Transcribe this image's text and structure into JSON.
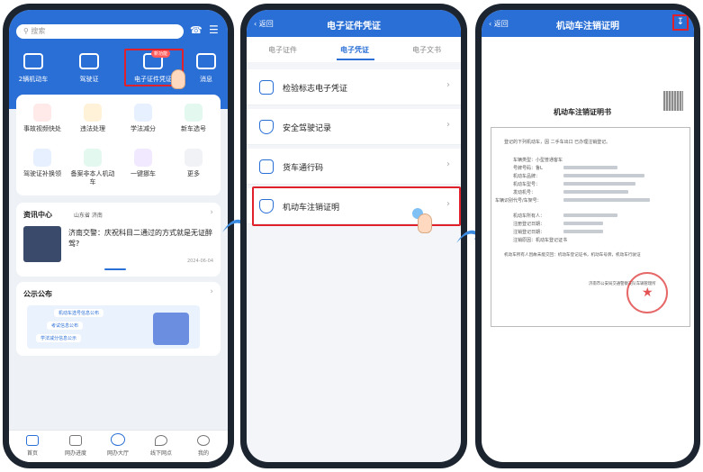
{
  "screen1": {
    "search_placeholder": "搜索",
    "icons": [
      {
        "label": "2辆机动车",
        "icon": "car-icon"
      },
      {
        "label": "驾驶证",
        "icon": "license-icon"
      },
      {
        "label": "电子证件凭证",
        "icon": "e-cert-icon",
        "badge": "新功能"
      },
      {
        "label": "消息",
        "icon": "message-icon"
      }
    ],
    "grid": [
      {
        "label": "事故视频快处",
        "color": "#ffe9e9"
      },
      {
        "label": "违法处理",
        "color": "#fff2d9"
      },
      {
        "label": "学法减分",
        "color": "#e6f0ff"
      },
      {
        "label": "新车选号",
        "color": "#e3f8ef"
      },
      {
        "label": "驾驶证补换领",
        "color": "#e6f0ff"
      },
      {
        "label": "备案非本人机动车",
        "color": "#e3f8ef"
      },
      {
        "label": "一键挪车",
        "color": "#f1e9ff"
      },
      {
        "label": "更多",
        "color": "#f0f2f5"
      }
    ],
    "news": {
      "section": "资讯中心",
      "region": "山东省 济南",
      "headline": "济南交警：庆祝科目二通过的方式就是无证醉驾?",
      "date": "2024-06-04"
    },
    "notice": {
      "section": "公示公布",
      "items": [
        "机动车选号信息公布",
        "考试信息公布",
        "学法减分信息公示"
      ]
    },
    "tabs": [
      {
        "label": "首页",
        "icon": "home-icon"
      },
      {
        "label": "网办进度",
        "icon": "monitor-icon"
      },
      {
        "label": "网办大厅",
        "icon": "hall-icon"
      },
      {
        "label": "线下网点",
        "icon": "location-icon"
      },
      {
        "label": "我的",
        "icon": "user-icon"
      }
    ]
  },
  "screen2": {
    "back": "返回",
    "title": "电子证件凭证",
    "tabs": [
      "电子证件",
      "电子凭证",
      "电子文书"
    ],
    "rows": [
      {
        "label": "检验标志电子凭证",
        "icon": "inspection-icon"
      },
      {
        "label": "安全驾驶记录",
        "icon": "shield-icon"
      },
      {
        "label": "货车通行码",
        "icon": "truck-code-icon"
      },
      {
        "label": "机动车注销证明",
        "icon": "cancel-cert-icon"
      }
    ]
  },
  "screen3": {
    "back": "返回",
    "title": "机动车注销证明",
    "doc_title": "机动车注销证明书",
    "intro": "登记的下列机动车，因 二手车出口 已办理注销登记。",
    "fields": [
      "车辆类型：小型普通客车",
      "号牌号码：鲁L",
      "机动车品牌：",
      "机动车型号：",
      "发动机号：",
      "车辆识别代号/车架号："
    ],
    "owner_fields": [
      "机动车所有人：",
      "注册登记日期：",
      "注销登记日期：",
      "注销原因：机动车登记证书"
    ],
    "note": "机动车所有人因故未能交回：机动车登记证书，机动车号牌，机动车行驶证",
    "issuer": "济南市公安局交通警察支队车辆管理所",
    "colors": {
      "primary": "#2a6fd6",
      "highlight": "#e0202a"
    }
  }
}
